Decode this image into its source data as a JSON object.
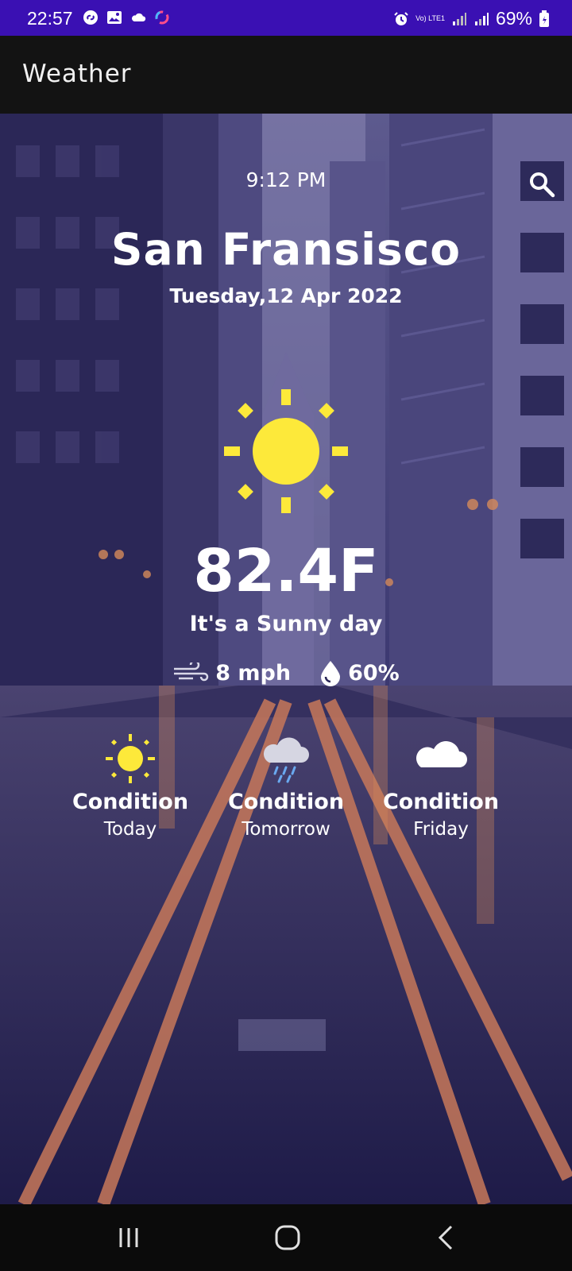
{
  "status_bar": {
    "time": "22:57",
    "network": "Vo) LTE1",
    "battery": "69%",
    "left_icons": [
      "shazam-icon",
      "image-icon",
      "cloud-icon",
      "sync-ring-icon"
    ],
    "right_icons": [
      "alarm-icon",
      "signal-icon",
      "signal-icon",
      "battery-icon"
    ]
  },
  "app_bar": {
    "title": "Weather"
  },
  "current": {
    "time": "9:12 PM",
    "city": "San Fransisco",
    "date": "Tuesday,12 Apr 2022",
    "temperature": "82.4F",
    "condition_text": "It's a Sunny day",
    "wind": "8 mph",
    "humidity": "60%",
    "icon": "sun-icon"
  },
  "forecast": [
    {
      "label": "Condition",
      "day": "Today",
      "icon": "sun-icon"
    },
    {
      "label": "Condition",
      "day": "Tomorrow",
      "icon": "rain-cloud-icon"
    },
    {
      "label": "Condition",
      "day": "Friday",
      "icon": "cloud-icon"
    }
  ],
  "colors": {
    "status_bar": "#3a10b3",
    "app_bar": "#131313",
    "sun": "#fde93a",
    "text": "#ffffff"
  }
}
